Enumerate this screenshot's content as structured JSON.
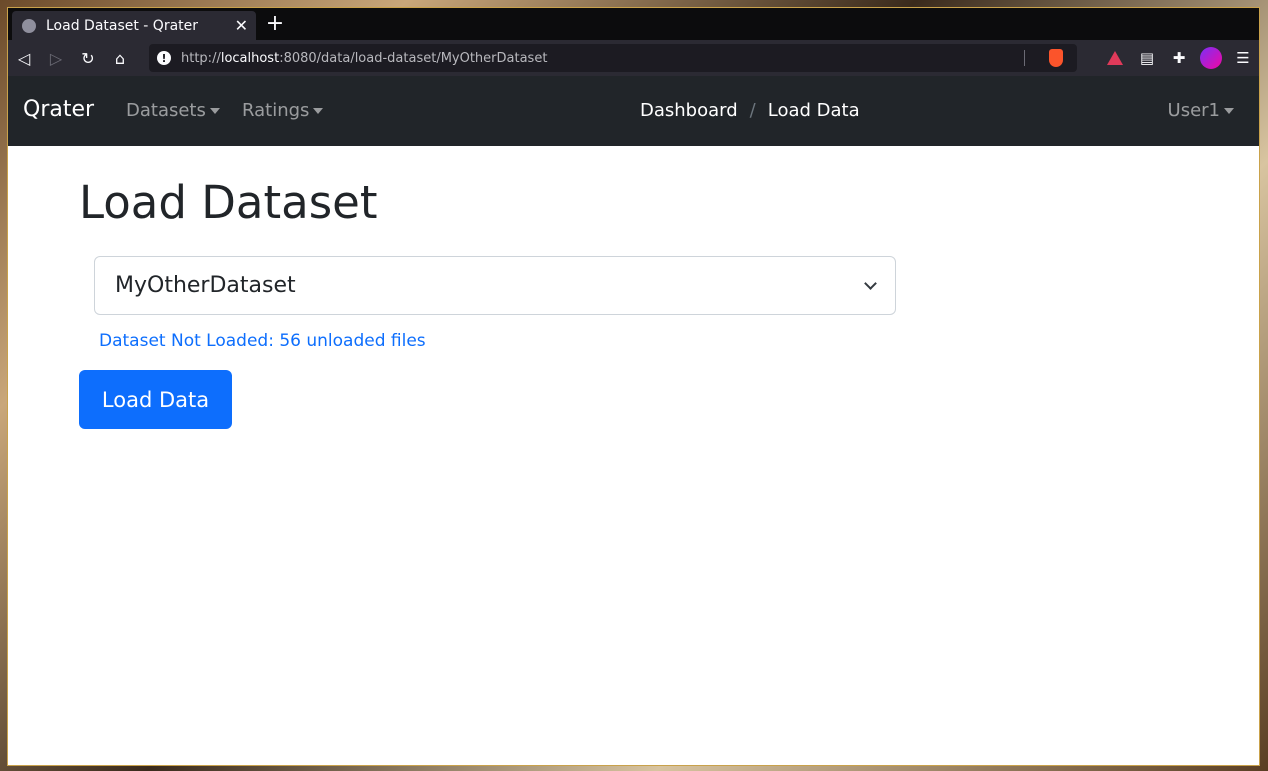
{
  "browser": {
    "tab_title": "Load Dataset - Qrater",
    "close_glyph": "✕",
    "newtab_glyph": "+",
    "url_prefix": "http://",
    "url_host": "localhost",
    "url_path": ":8080/data/load-dataset/MyOtherDataset",
    "icons": [
      "back-icon",
      "forward-icon",
      "reload-icon",
      "bookmark-icon",
      "info-icon",
      "brave-shield-icon",
      "brave-rewards-icon",
      "reader-icon",
      "extensions-icon",
      "profile-icon",
      "menu-icon"
    ]
  },
  "navbar": {
    "brand": "Qrater",
    "datasets": "Datasets",
    "ratings": "Ratings",
    "breadcrumb_dashboard": "Dashboard",
    "breadcrumb_sep": "/",
    "breadcrumb_current": "Load Data",
    "user": "User1"
  },
  "main": {
    "title": "Load Dataset",
    "selected_dataset": "MyOtherDataset",
    "status": "Dataset Not Loaded: 56 unloaded files",
    "load_button": "Load Data"
  },
  "colors": {
    "navbar_bg": "#212529",
    "primary": "#0d6efd"
  }
}
